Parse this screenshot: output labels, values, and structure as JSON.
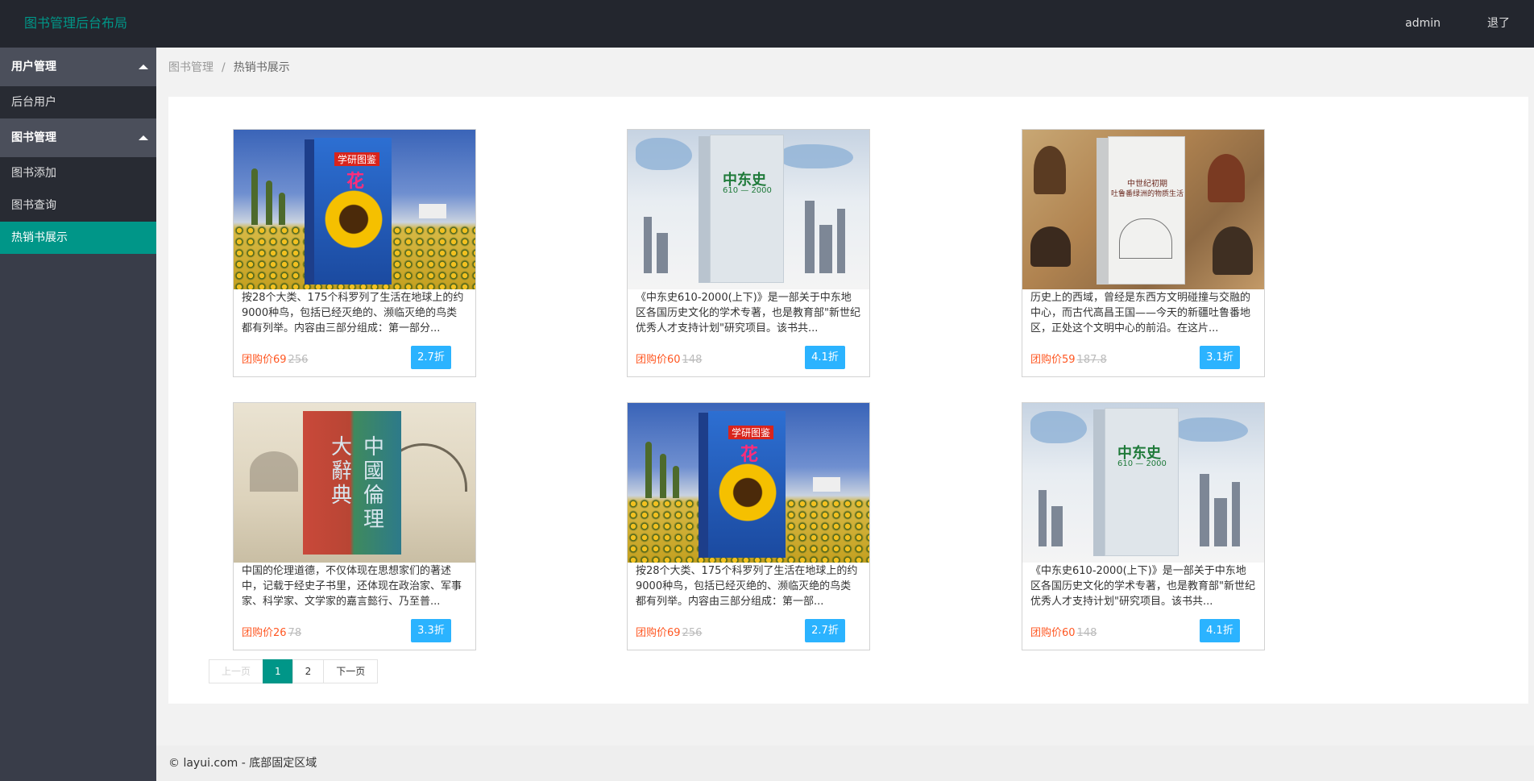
{
  "header": {
    "logo": "图书管理后台布局",
    "user": "admin",
    "logout": "退了"
  },
  "sidebar": {
    "groups": [
      {
        "label": "用户管理",
        "items": [
          {
            "label": "后台用户"
          }
        ]
      },
      {
        "label": "图书管理",
        "items": [
          {
            "label": "图书添加"
          },
          {
            "label": "图书查询"
          },
          {
            "label": "热销书展示",
            "active": true
          }
        ]
      }
    ]
  },
  "breadcrumb": {
    "home": "图书管理",
    "separator": "/",
    "current": "热销书展示"
  },
  "books": [
    {
      "cover": "sunflower",
      "desc": "按28个大类、175个科罗列了生活在地球上的约9000种鸟，包括已经灭绝的、濒临灭绝的鸟类都有列举。内容由三部分组成：第一部分...",
      "price_label": "团购价69",
      "old_price": "256",
      "discount": "2.7折"
    },
    {
      "cover": "city",
      "desc": "《中东史610-2000(上下)》是一部关于中东地区各国历史文化的学术专著，也是教育部\"新世纪优秀人才支持计划\"研究项目。该书共...",
      "price_label": "团购价60",
      "old_price": "148",
      "discount": "4.1折"
    },
    {
      "cover": "painting",
      "desc": "历史上的西域，曾经是东西方文明碰撞与交融的中心，而古代高昌王国——今天的新疆吐鲁番地区，正处这个文明中心的前沿。在这片...",
      "price_label": "团购价59",
      "old_price": "187.8",
      "discount": "3.1折"
    },
    {
      "cover": "ink",
      "desc": "中国的伦理道德，不仅体现在思想家们的著述中，记载于经史子书里，还体现在政治家、军事家、科学家、文学家的嘉言懿行、乃至普...",
      "price_label": "团购价26",
      "old_price": "78",
      "discount": "3.3折"
    },
    {
      "cover": "sunflower",
      "desc": "按28个大类、175个科罗列了生活在地球上的约9000种鸟，包括已经灭绝的、濒临灭绝的鸟类都有列举。内容由三部分组成：第一部...",
      "price_label": "团购价69",
      "old_price": "256",
      "discount": "2.7折"
    },
    {
      "cover": "city",
      "desc": "《中东史610-2000(上下)》是一部关于中东地区各国历史文化的学术专著，也是教育部\"新世纪优秀人才支持计划\"研究项目。该书共...",
      "price_label": "团购价60",
      "old_price": "148",
      "discount": "4.1折"
    }
  ],
  "covers": {
    "sunflower": {
      "series": "学研图鉴",
      "title": "花"
    },
    "city": {
      "title": "中东史",
      "subtitle": "610 — 2000"
    },
    "painting": {
      "title_line1": "中世纪初期",
      "title_line2": "吐鲁番绿洲的物质生活"
    },
    "ink": {
      "title_a": "中國",
      "title_b": "倫理",
      "title_c": "大辭",
      "title_d": "典"
    }
  },
  "pager": {
    "prev": "上一页",
    "pages": [
      "1",
      "2"
    ],
    "current": "1",
    "next": "下一页"
  },
  "footer": {
    "text": "© layui.com - 底部固定区域"
  }
}
